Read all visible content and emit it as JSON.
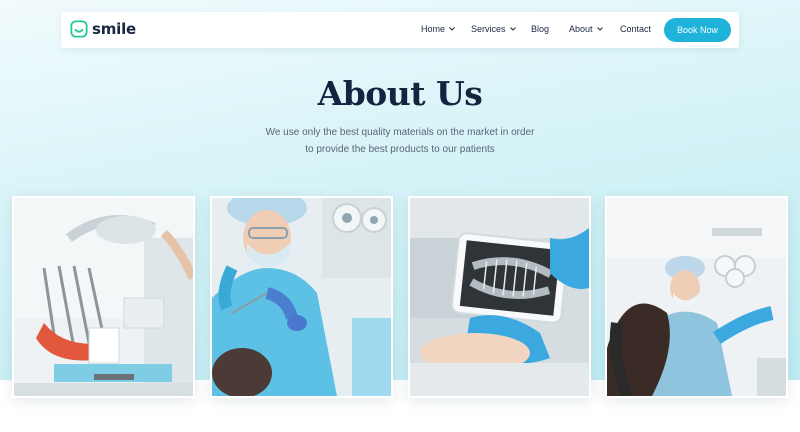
{
  "brand": {
    "name": "smile",
    "accent": "#1fb3dc",
    "logo_color": "#20c997"
  },
  "nav": {
    "items": [
      {
        "label": "Home",
        "dropdown": true
      },
      {
        "label": "Services",
        "dropdown": true
      },
      {
        "label": "Blog",
        "dropdown": false
      },
      {
        "label": "About",
        "dropdown": true
      },
      {
        "label": "Contact",
        "dropdown": false
      }
    ],
    "cta": "Book Now"
  },
  "hero": {
    "title": "About Us",
    "subtitle_line1": "We use only the best quality materials on the market in order",
    "subtitle_line2": "to provide the best products to our patients"
  },
  "gallery": [
    {
      "icon": "dental-chair-photo"
    },
    {
      "icon": "dentist-working-photo"
    },
    {
      "icon": "xray-tablet-photo"
    },
    {
      "icon": "patient-exam-photo"
    }
  ]
}
